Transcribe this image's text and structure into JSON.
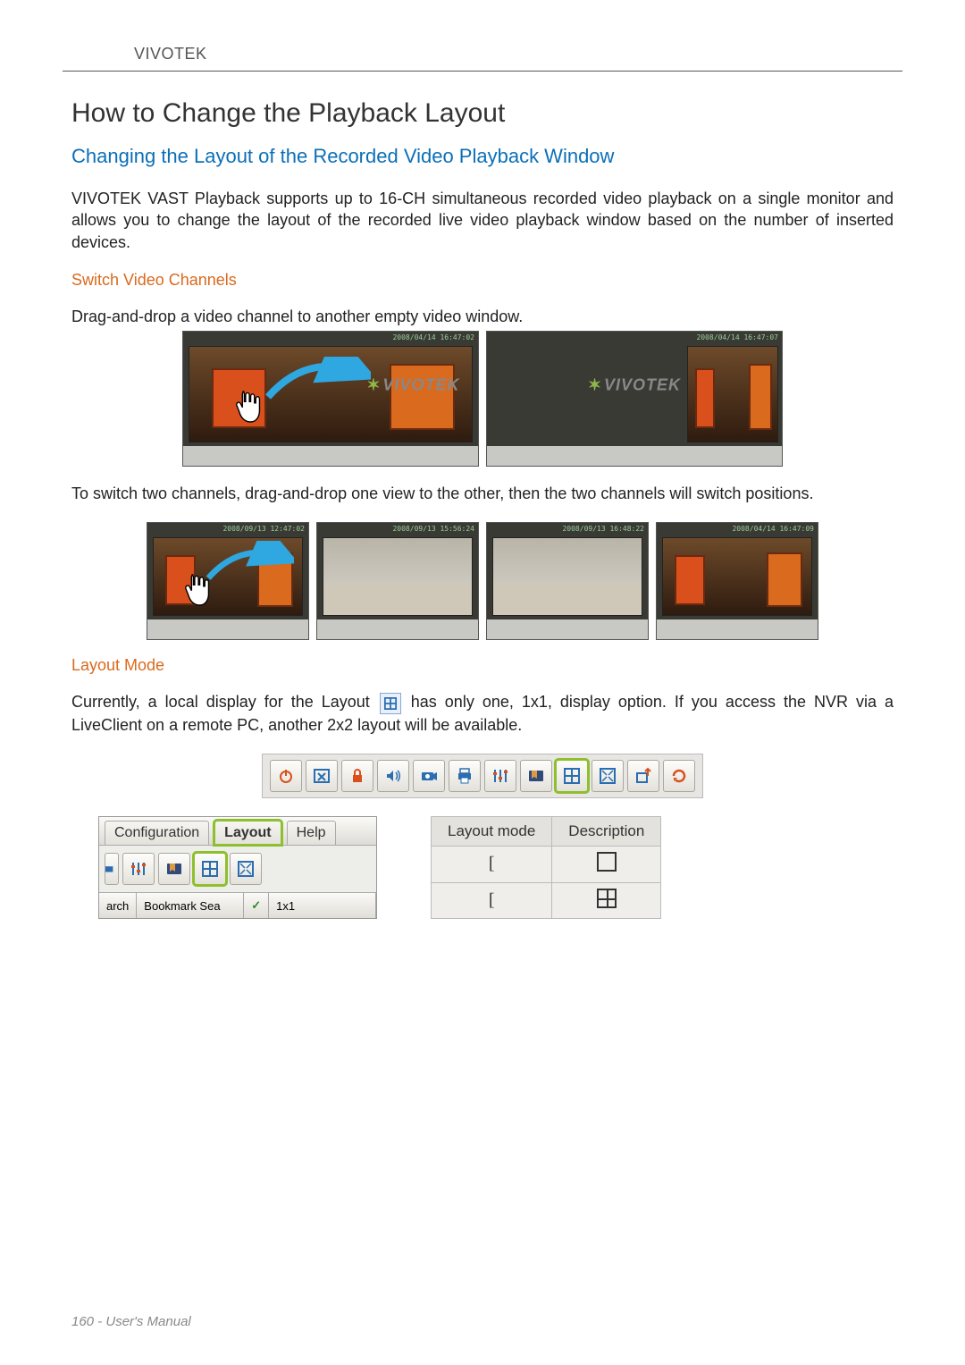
{
  "brand": "VIVOTEK",
  "title": "How to Change the Playback Layout",
  "subtitle": "Changing the Layout of the Recorded Video Playback Window",
  "intro": "VIVOTEK VAST Playback supports up to 16-CH simultaneous recorded video playback on a single monitor and allows you to change the layout of the recorded live video playback window based on the number of inserted devices.",
  "section_switch": "Switch Video Channels",
  "switch_p1": "Drag-and-drop a video channel to another empty video window.",
  "switch_p2": "To switch two channels, drag-and-drop one view to the other, then the two channels will switch positions.",
  "section_layout": "Layout Mode",
  "layout_p_pre": "Currently, a local display for the Layout ",
  "layout_p_post": " has only one, 1x1, display option. If you access the NVR via a LiveClient on a remote PC, another 2x2 layout will be available.",
  "video_timestamps": {
    "a": "2008/04/14 16:47:02",
    "b": "2008/04/14 16:47:07",
    "c": "2008/09/13 12:47:02",
    "d": "2008/09/13 15:56:24",
    "e": "2008/09/13 16:48:22",
    "f": "2008/04/14 16:47:09"
  },
  "vivotek_logo_text": "VIVOTEK",
  "toolbar_icons": [
    "power-icon",
    "close-window-icon",
    "lock-icon",
    "volume-icon",
    "camera-switch-icon",
    "print-icon",
    "settings-sliders-icon",
    "bookmark-icon",
    "layout-grid-icon",
    "fullscreen-icon",
    "export-icon",
    "refresh-icon"
  ],
  "toolbar_highlight_index": 8,
  "menu": {
    "tabs": [
      "Configuration",
      "Layout",
      "Help"
    ],
    "active_tab_index": 1,
    "icons": [
      "settings-sliders-icon",
      "bookmark-icon",
      "layout-grid-icon",
      "fullscreen-icon"
    ],
    "layout_icon_index": 2,
    "submenu": {
      "left_a": "arch",
      "left_b": "Bookmark Sea",
      "check": "✓",
      "value": "1x1"
    }
  },
  "table": {
    "headers": [
      "Layout mode",
      "Description"
    ],
    "rows": [
      {
        "mode": "[",
        "desc": "1x1"
      },
      {
        "mode": "[",
        "desc": "2x2"
      }
    ]
  },
  "footer": "160 - User's Manual"
}
